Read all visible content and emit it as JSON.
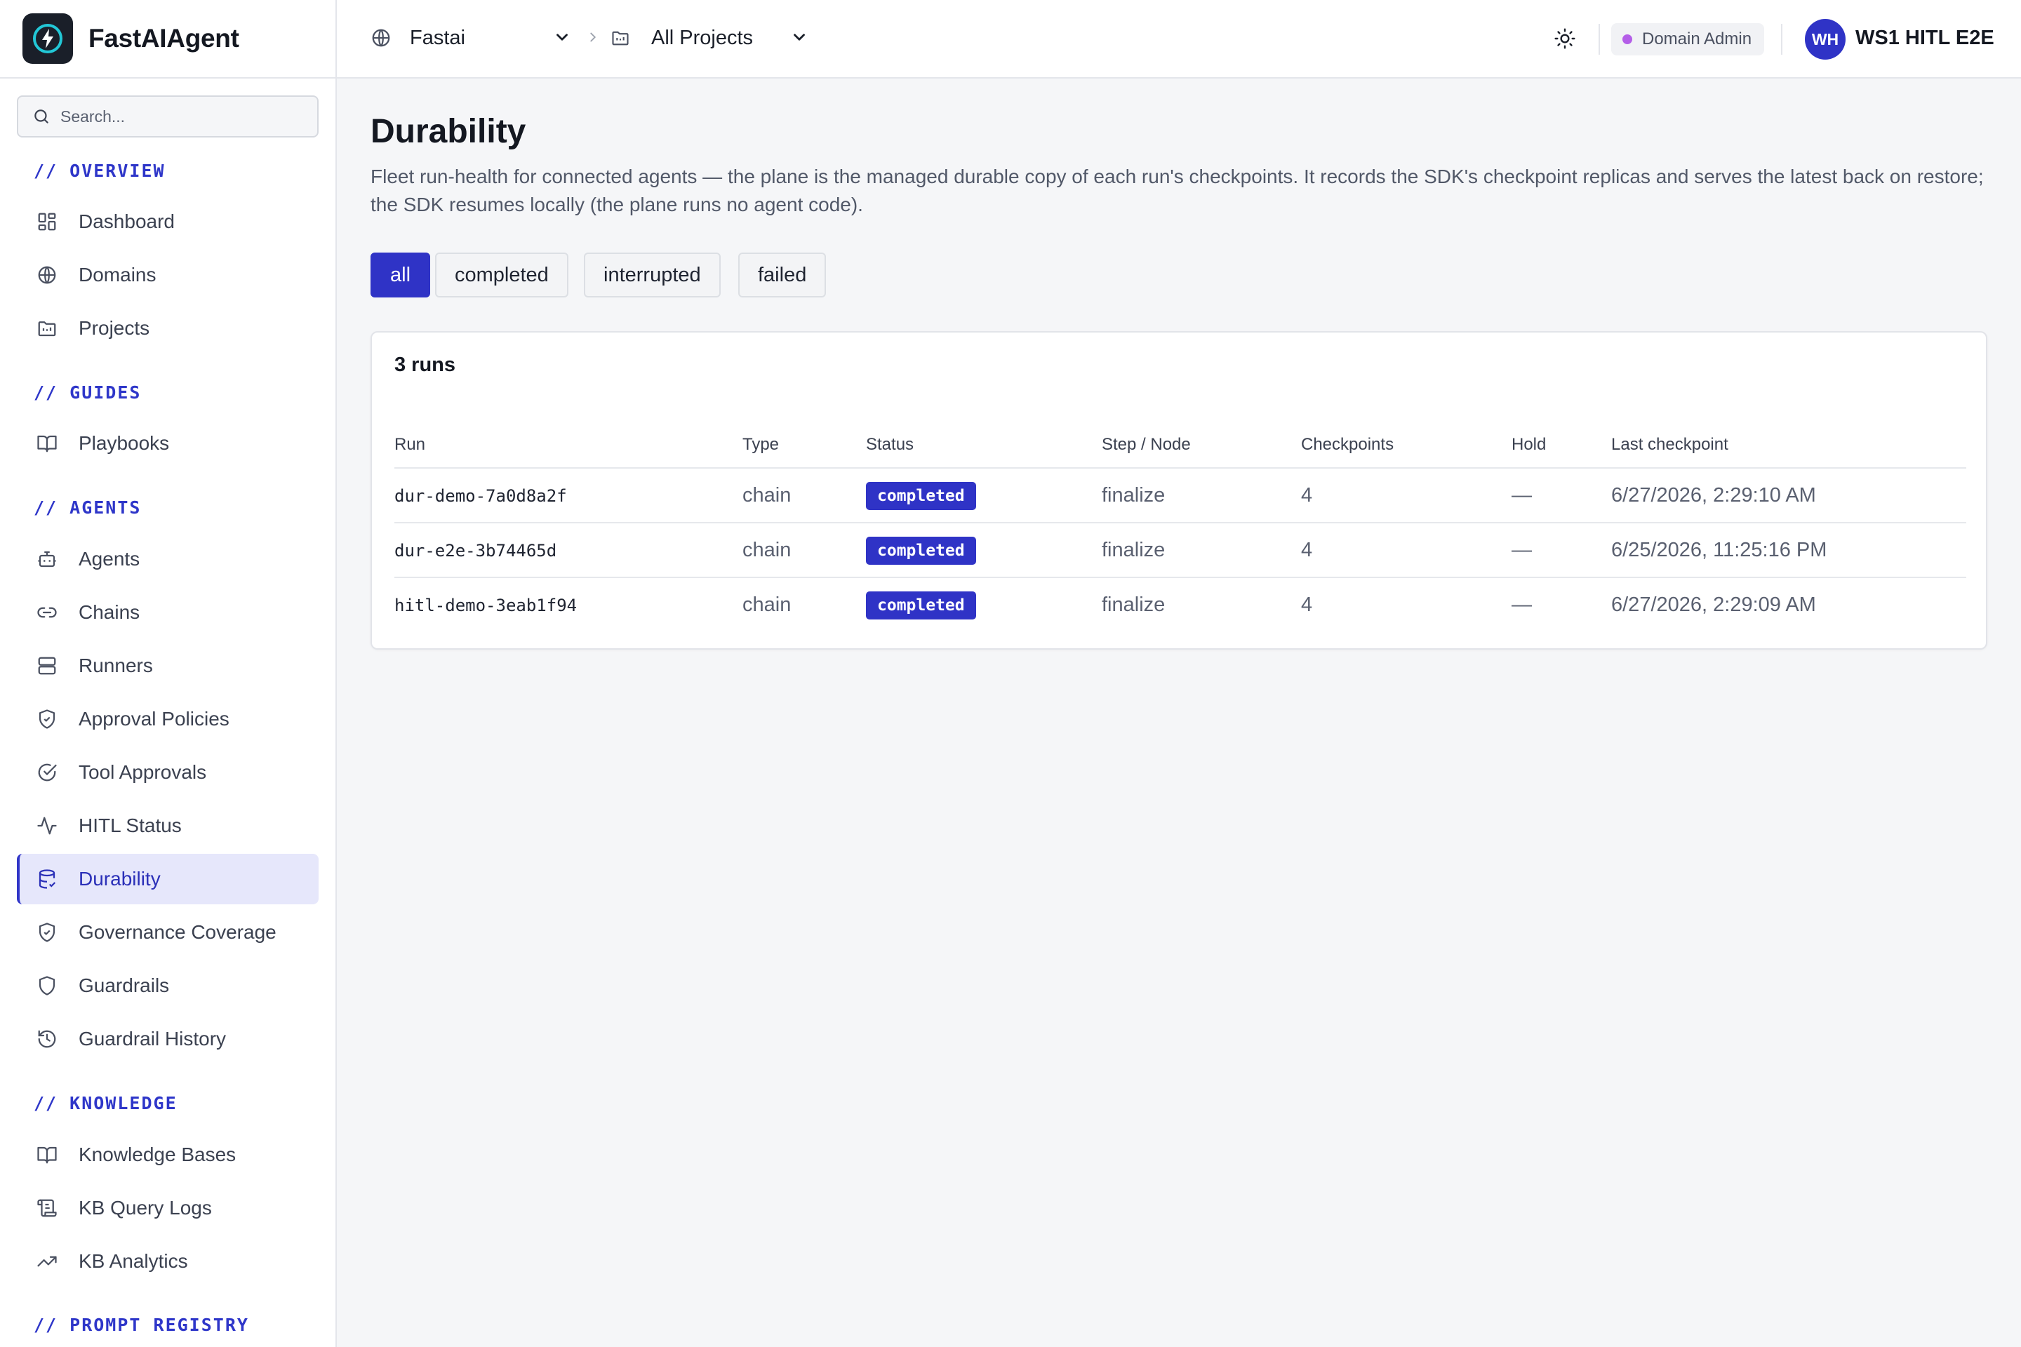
{
  "app": {
    "name": "FastAIAgent"
  },
  "search": {
    "placeholder": "Search..."
  },
  "sidebar": {
    "sections": [
      {
        "title": "// OVERVIEW",
        "items": [
          {
            "label": "Dashboard",
            "icon": "dashboard-icon"
          },
          {
            "label": "Domains",
            "icon": "globe-icon"
          },
          {
            "label": "Projects",
            "icon": "folder-icon"
          }
        ]
      },
      {
        "title": "// GUIDES",
        "items": [
          {
            "label": "Playbooks",
            "icon": "book-icon"
          }
        ]
      },
      {
        "title": "// AGENTS",
        "items": [
          {
            "label": "Agents",
            "icon": "bot-icon"
          },
          {
            "label": "Chains",
            "icon": "link-icon"
          },
          {
            "label": "Runners",
            "icon": "server-icon"
          },
          {
            "label": "Approval Policies",
            "icon": "shield-check-icon"
          },
          {
            "label": "Tool Approvals",
            "icon": "check-circle-icon"
          },
          {
            "label": "HITL Status",
            "icon": "activity-icon"
          },
          {
            "label": "Durability",
            "icon": "database-icon",
            "active": true
          },
          {
            "label": "Governance Coverage",
            "icon": "shield-check-icon"
          },
          {
            "label": "Guardrails",
            "icon": "shield-icon"
          },
          {
            "label": "Guardrail History",
            "icon": "history-icon"
          }
        ]
      },
      {
        "title": "// KNOWLEDGE",
        "items": [
          {
            "label": "Knowledge Bases",
            "icon": "book-icon"
          },
          {
            "label": "KB Query Logs",
            "icon": "scroll-icon"
          },
          {
            "label": "KB Analytics",
            "icon": "trending-up-icon"
          }
        ]
      },
      {
        "title": "// PROMPT REGISTRY",
        "items": []
      }
    ]
  },
  "topbar": {
    "domain": "Fastai",
    "project": "All Projects",
    "role": "Domain Admin",
    "avatar_initials": "WH",
    "user_name": "WS1 HITL E2E"
  },
  "page": {
    "title": "Durability",
    "description": "Fleet run-health for connected agents — the plane is the managed durable copy of each run's checkpoints. It records the SDK's checkpoint replicas and serves the latest back on restore; the SDK resumes locally (the plane runs no agent code).",
    "filters": [
      "all",
      "completed",
      "interrupted",
      "failed"
    ],
    "active_filter": "all"
  },
  "table": {
    "count_label": "3 runs",
    "columns": [
      "Run",
      "Type",
      "Status",
      "Step / Node",
      "Checkpoints",
      "Hold",
      "Last checkpoint"
    ],
    "rows": [
      {
        "run": "dur-demo-7a0d8a2f",
        "type": "chain",
        "status": "completed",
        "step": "finalize",
        "checkpoints": "4",
        "hold": "—",
        "last": "6/27/2026, 2:29:10 AM"
      },
      {
        "run": "dur-e2e-3b74465d",
        "type": "chain",
        "status": "completed",
        "step": "finalize",
        "checkpoints": "4",
        "hold": "—",
        "last": "6/25/2026, 11:25:16 PM"
      },
      {
        "run": "hitl-demo-3eab1f94",
        "type": "chain",
        "status": "completed",
        "step": "finalize",
        "checkpoints": "4",
        "hold": "—",
        "last": "6/27/2026, 2:29:09 AM"
      }
    ]
  },
  "colors": {
    "accent": "#2f33c6",
    "active_bg": "#e6e7fb",
    "role_dot": "#b45ee8"
  }
}
